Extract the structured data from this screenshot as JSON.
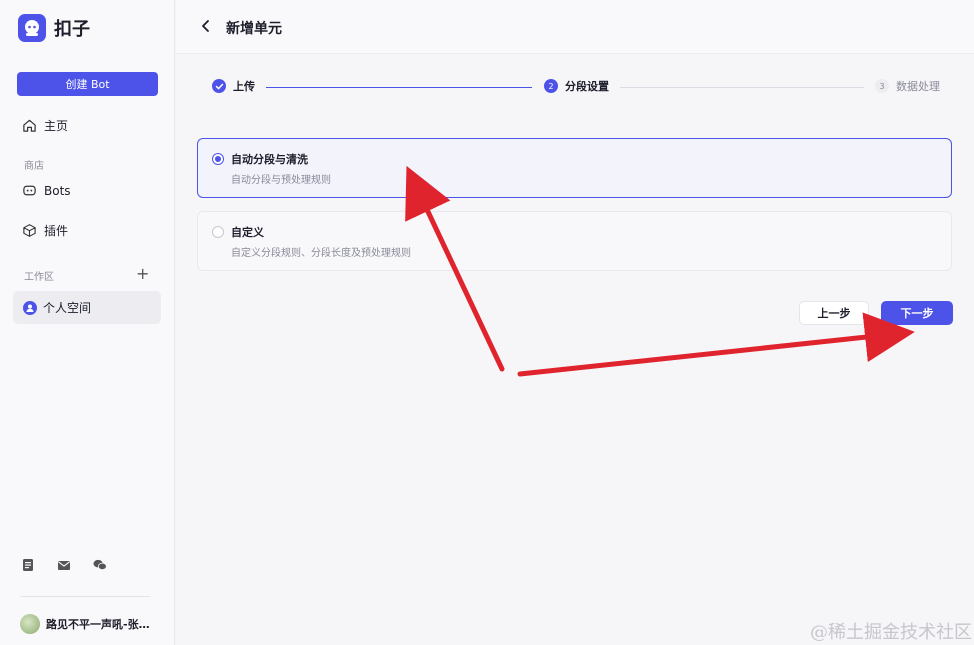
{
  "app": {
    "name": "扣子"
  },
  "sidebar": {
    "create_label": "创建 Bot",
    "home_label": "主页",
    "store_section": "商店",
    "bots_label": "Bots",
    "plugins_label": "插件",
    "workspace_section": "工作区",
    "workspace_add": "+",
    "personal_space": "个人空间",
    "user_name": "路见不平一声吼-张…"
  },
  "header": {
    "title": "新增单元"
  },
  "steps": [
    {
      "number": "1",
      "label": "上传",
      "state": "done"
    },
    {
      "number": "2",
      "label": "分段设置",
      "state": "active"
    },
    {
      "number": "3",
      "label": "数据处理",
      "state": "pending"
    }
  ],
  "options": [
    {
      "title": "自动分段与清洗",
      "desc": "自动分段与预处理规则",
      "selected": true
    },
    {
      "title": "自定义",
      "desc": "自定义分段规则、分段长度及预处理规则",
      "selected": false
    }
  ],
  "buttons": {
    "prev": "上一步",
    "next": "下一步"
  },
  "watermark": "@稀土掘金技术社区",
  "colors": {
    "accent": "#4d53e8",
    "annotation_arrow": "#e0242e"
  }
}
